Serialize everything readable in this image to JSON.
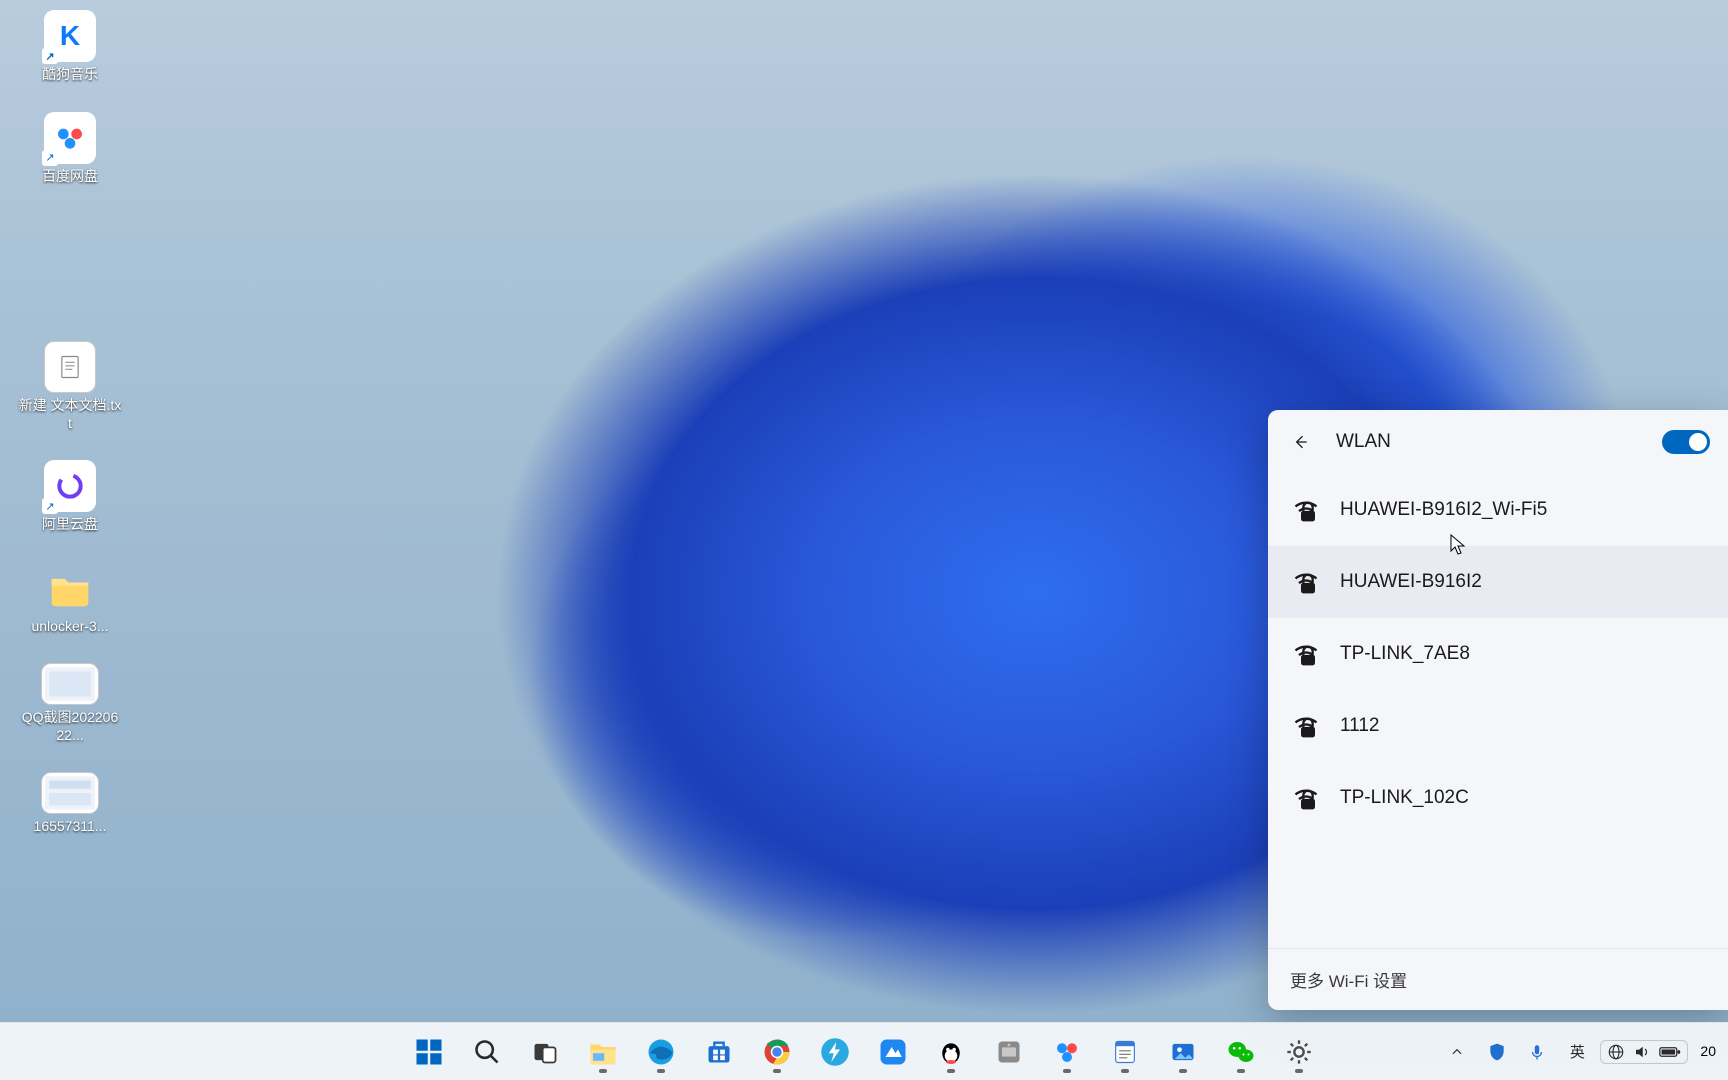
{
  "desktop": {
    "icons": [
      {
        "label": "酷狗音乐",
        "kind": "app-kugou",
        "bg": "#ffffff",
        "fg": "#0a7aff"
      },
      {
        "label": "百度网盘",
        "kind": "app-baidupan",
        "bg": "#ffffff",
        "fg": "#2191ff"
      },
      {
        "label": "新建 文本文档.txt",
        "kind": "file-txt",
        "bg": "#ffffff",
        "fg": "#5a5a5a"
      },
      {
        "label": "阿里云盘",
        "kind": "app-aliyun",
        "bg": "#ffffff",
        "fg": "#6f3ff5"
      },
      {
        "label": "unlocker-3...",
        "kind": "folder",
        "bg": "#ffd667",
        "fg": "#c88700"
      },
      {
        "label": "QQ截图20220622...",
        "kind": "file-img",
        "bg": "#ffffff",
        "fg": "#2a6fd6"
      },
      {
        "label": "16557311...",
        "kind": "file-img",
        "bg": "#ffffff",
        "fg": "#2a6fd6"
      }
    ]
  },
  "flyout": {
    "title": "WLAN",
    "toggle_on": true,
    "networks": [
      {
        "ssid": "HUAWEI-B916I2_Wi-Fi5",
        "secured": true,
        "hover": false
      },
      {
        "ssid": "HUAWEI-B916I2",
        "secured": true,
        "hover": true
      },
      {
        "ssid": "TP-LINK_7AE8",
        "secured": true,
        "hover": false
      },
      {
        "ssid": "1112",
        "secured": true,
        "hover": false
      },
      {
        "ssid": "TP-LINK_102C",
        "secured": true,
        "hover": false
      }
    ],
    "more_label": "更多 Wi-Fi 设置"
  },
  "taskbar": {
    "center_apps": [
      {
        "name": "start",
        "running": false
      },
      {
        "name": "search",
        "running": false
      },
      {
        "name": "task-view",
        "running": false
      },
      {
        "name": "file-explorer",
        "running": true
      },
      {
        "name": "edge",
        "running": true
      },
      {
        "name": "ms-store",
        "running": false
      },
      {
        "name": "chrome",
        "running": true
      },
      {
        "name": "thunder",
        "running": false
      },
      {
        "name": "qq-browser",
        "running": false
      },
      {
        "name": "qq",
        "running": true
      },
      {
        "name": "potplayer",
        "running": false
      },
      {
        "name": "baidupan",
        "running": true
      },
      {
        "name": "notepad",
        "running": true
      },
      {
        "name": "photos",
        "running": true
      },
      {
        "name": "wechat",
        "running": true
      },
      {
        "name": "settings",
        "running": true
      }
    ],
    "tray": {
      "overflow": "˄",
      "security": "shield",
      "mic": "mic",
      "ime_lang": "英",
      "net_icon": "globe",
      "vol_icon": "speaker",
      "battery_icon": "battery",
      "clock_partial": "20"
    }
  }
}
